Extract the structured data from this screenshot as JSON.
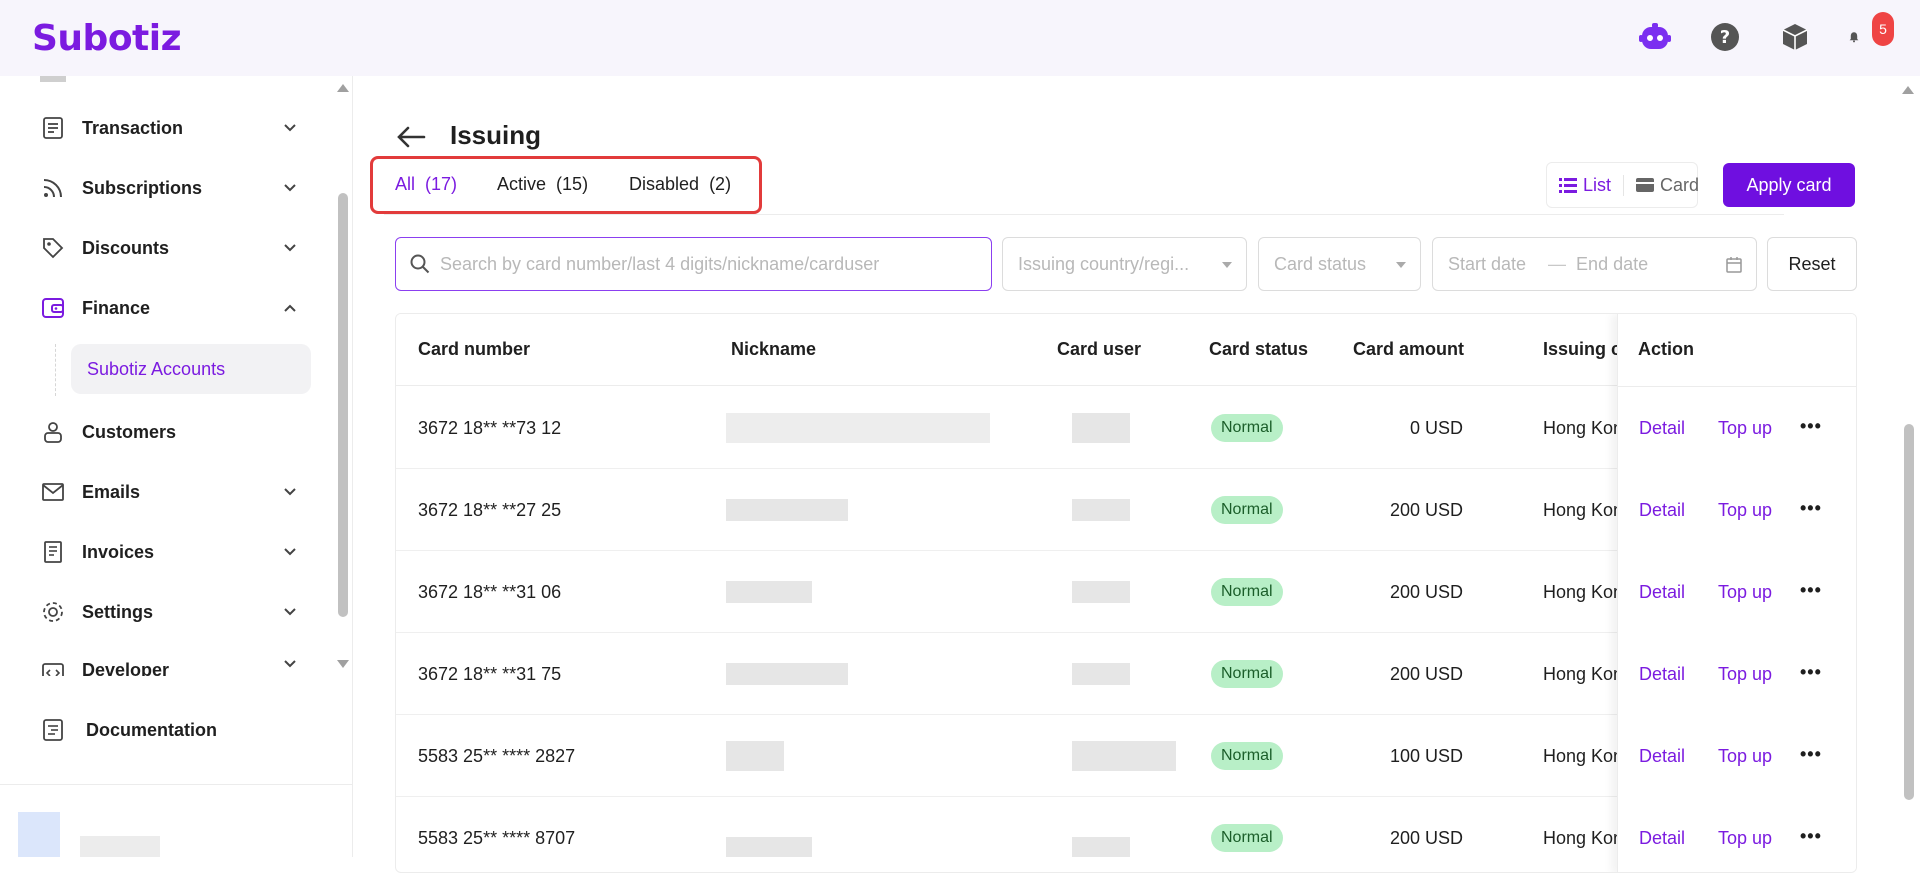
{
  "app": {
    "logo": "Subotiz",
    "notification_count": "5"
  },
  "topbar_icons": [
    "assistant-bot-icon",
    "help-icon",
    "package-icon",
    "bell-icon"
  ],
  "sidebar": {
    "items": [
      {
        "label": "Transaction",
        "icon": "list-icon",
        "expandable": true,
        "expanded": false
      },
      {
        "label": "Subscriptions",
        "icon": "rss-icon",
        "expandable": true,
        "expanded": false
      },
      {
        "label": "Discounts",
        "icon": "tag-icon",
        "expandable": true,
        "expanded": false
      },
      {
        "label": "Finance",
        "icon": "wallet-icon",
        "expandable": true,
        "expanded": true
      },
      {
        "label": "Customers",
        "icon": "user-icon",
        "expandable": false
      },
      {
        "label": "Emails",
        "icon": "mail-icon",
        "expandable": true,
        "expanded": false
      },
      {
        "label": "Invoices",
        "icon": "invoice-icon",
        "expandable": true,
        "expanded": false
      },
      {
        "label": "Settings",
        "icon": "gear-icon",
        "expandable": true,
        "expanded": false
      },
      {
        "label": "Developer",
        "icon": "code-icon",
        "expandable": true,
        "expanded": false
      },
      {
        "label": "Documentation",
        "icon": "document-icon",
        "expandable": false
      }
    ],
    "finance_sub": {
      "label": "Subotiz Accounts"
    }
  },
  "page": {
    "title": "Issuing",
    "tabs": [
      {
        "label": "All",
        "count": "(17)",
        "active": true
      },
      {
        "label": "Active",
        "count": "(15)",
        "active": false
      },
      {
        "label": "Disabled",
        "count": "(2)",
        "active": false
      }
    ],
    "view_toggle": {
      "list": "List",
      "card": "Card",
      "selected": "list"
    },
    "apply_button": "Apply card"
  },
  "filters": {
    "search_placeholder": "Search by card number/last 4 digits/nickname/carduser",
    "country_placeholder": "Issuing country/regi...",
    "status_placeholder": "Card status",
    "start_date": "Start date",
    "date_sep": "—",
    "end_date": "End date",
    "reset": "Reset"
  },
  "table": {
    "headers": {
      "card_number": "Card number",
      "nickname": "Nickname",
      "card_user": "Card user",
      "card_status": "Card status",
      "card_amount": "Card amount",
      "issuing": "Issuing c",
      "action": "Action"
    },
    "actions": {
      "detail": "Detail",
      "top_up": "Top up",
      "more": "•••"
    },
    "rows": [
      {
        "card_number": "3672 18** **73 12",
        "status": "Normal",
        "amount": "0 USD",
        "issuing": "Hong Kon"
      },
      {
        "card_number": "3672 18** **27 25",
        "status": "Normal",
        "amount": "200 USD",
        "issuing": "Hong Kon"
      },
      {
        "card_number": "3672 18** **31 06",
        "status": "Normal",
        "amount": "200 USD",
        "issuing": "Hong Kon"
      },
      {
        "card_number": "3672 18** **31 75",
        "status": "Normal",
        "amount": "200 USD",
        "issuing": "Hong Kon"
      },
      {
        "card_number": "5583 25** **** 2827",
        "status": "Normal",
        "amount": "100 USD",
        "issuing": "Hong Kon"
      },
      {
        "card_number": "5583 25** **** 8707",
        "status": "Normal",
        "amount": "200 USD",
        "issuing": "Hong Kon"
      }
    ]
  },
  "colors": {
    "brand": "#7b1be0",
    "button": "#6f0fe0",
    "status_bg": "#b8efc7",
    "highlight_box": "#e23b3b"
  }
}
